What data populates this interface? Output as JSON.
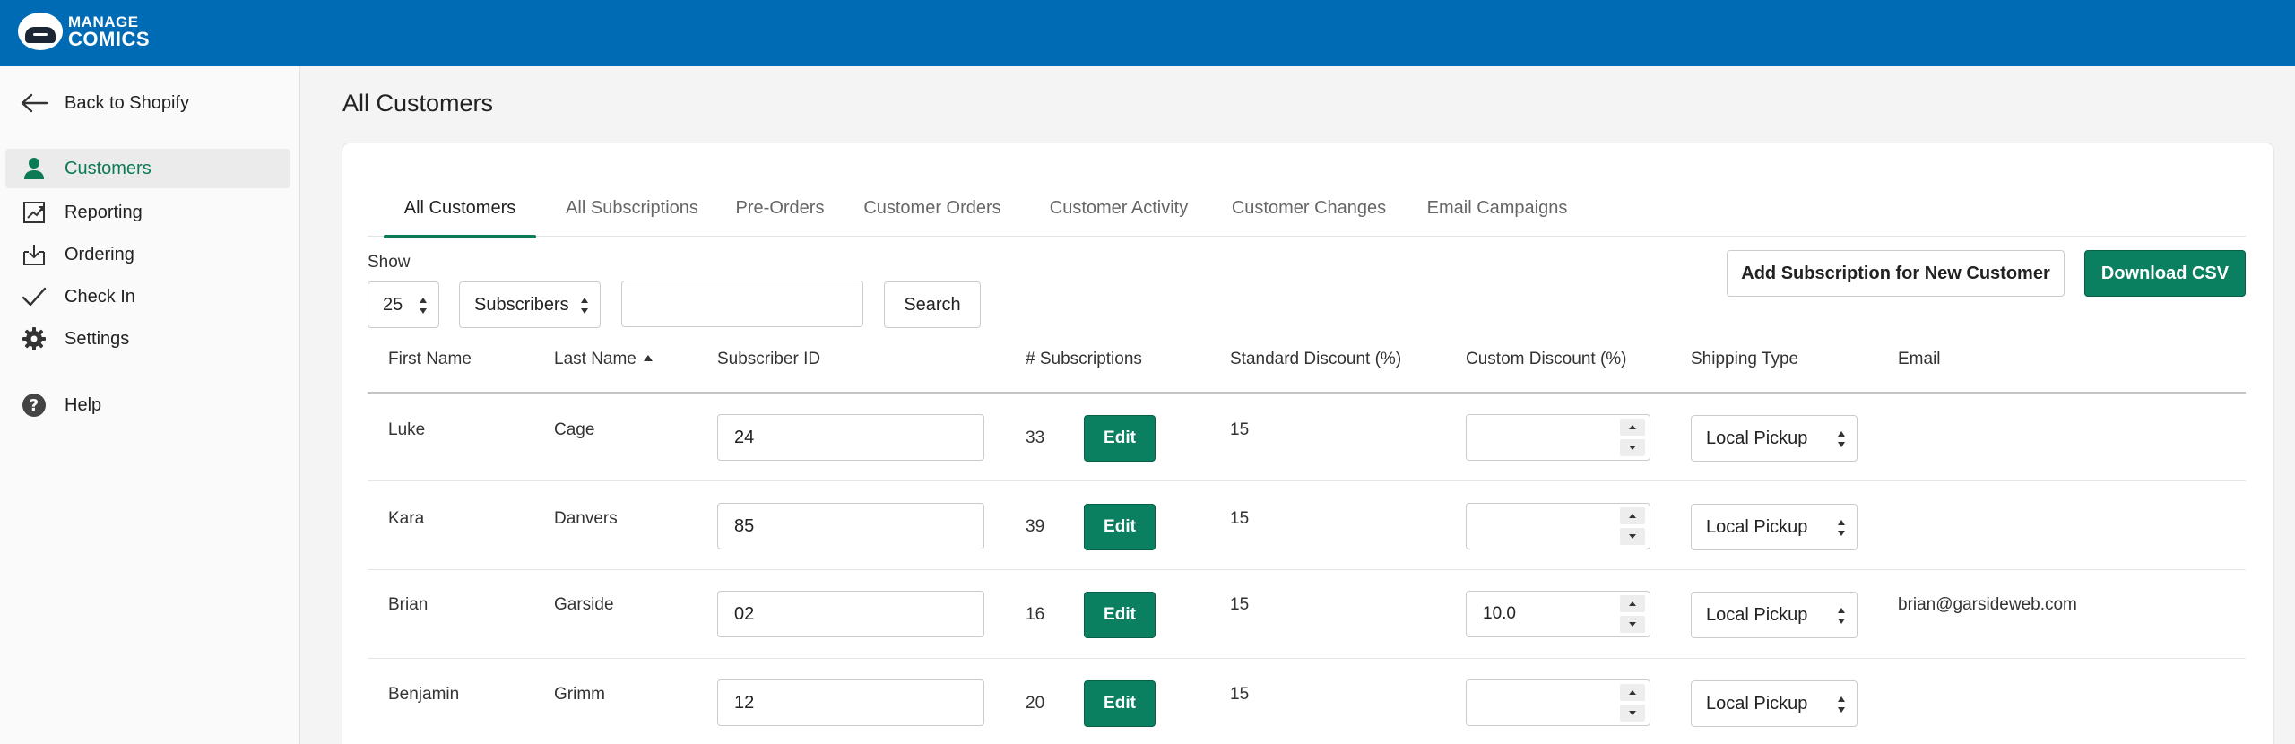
{
  "brand": {
    "line1": "MANAGE",
    "line2": "COMICS"
  },
  "sidebar": {
    "back": "Back to Shopify",
    "items": [
      {
        "label": "Customers",
        "icon": "person-icon",
        "active": true
      },
      {
        "label": "Reporting",
        "icon": "reporting-icon",
        "active": false
      },
      {
        "label": "Ordering",
        "icon": "ordering-icon",
        "active": false
      },
      {
        "label": "Check In",
        "icon": "checkmark-icon",
        "active": false
      },
      {
        "label": "Settings",
        "icon": "gear-icon",
        "active": false
      }
    ],
    "help": "Help"
  },
  "page": {
    "title": "All Customers"
  },
  "tabs": [
    "All Customers",
    "All Subscriptions",
    "Pre-Orders",
    "Customer Orders",
    "Customer Activity",
    "Customer Changes",
    "Email Campaigns"
  ],
  "toolbar": {
    "show_label": "Show",
    "page_size": "25",
    "filter": "Subscribers",
    "search_value": "",
    "search_button": "Search",
    "add_button": "Add Subscription for New Customer",
    "download_button": "Download CSV"
  },
  "table": {
    "headers": [
      "First Name",
      "Last Name",
      "Subscriber ID",
      "# Subscriptions",
      "Standard Discount (%)",
      "Custom Discount (%)",
      "Shipping Type",
      "Email"
    ],
    "sort_column": "Last Name",
    "edit_label": "Edit",
    "rows": [
      {
        "first": "Luke",
        "last": "Cage",
        "subscriber_id": "24",
        "subs": "33",
        "std_discount": "15",
        "custom_discount": "",
        "shipping": "Local Pickup",
        "email": ""
      },
      {
        "first": "Kara",
        "last": "Danvers",
        "subscriber_id": "85",
        "subs": "39",
        "std_discount": "15",
        "custom_discount": "",
        "shipping": "Local Pickup",
        "email": ""
      },
      {
        "first": "Brian",
        "last": "Garside",
        "subscriber_id": "02",
        "subs": "16",
        "std_discount": "15",
        "custom_discount": "10.0",
        "shipping": "Local Pickup",
        "email": "brian@garsideweb.com"
      },
      {
        "first": "Benjamin",
        "last": "Grimm",
        "subscriber_id": "12",
        "subs": "20",
        "std_discount": "15",
        "custom_discount": "",
        "shipping": "Local Pickup",
        "email": ""
      }
    ]
  },
  "colors": {
    "header_blue": "#006bb5",
    "accent_green": "#0b8060"
  }
}
